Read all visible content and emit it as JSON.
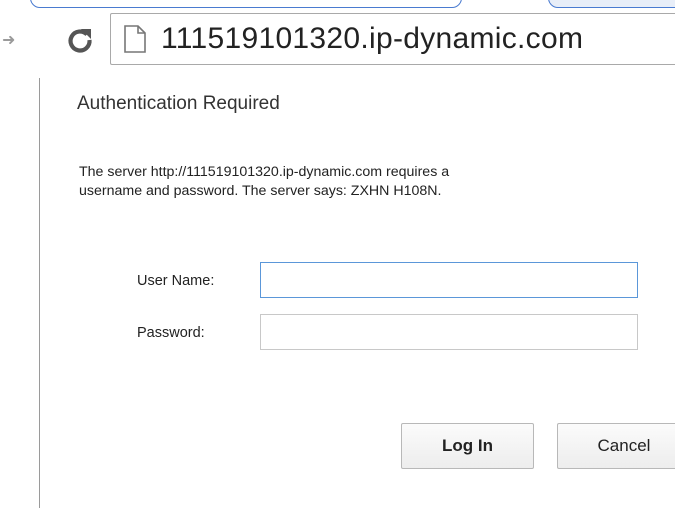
{
  "browser": {
    "address_bar": {
      "url": "111519101320.ip-dynamic.com"
    },
    "icons": {
      "forward": "forward-arrow-icon",
      "reload": "reload-icon",
      "page": "page-icon"
    }
  },
  "dialog": {
    "title": "Authentication Required",
    "message_line1": "The server http://111519101320.ip-dynamic.com requires a",
    "message_line2": "username and password. The server says: ZXHN H108N.",
    "username_label": "User Name:",
    "username_value": "",
    "password_label": "Password:",
    "password_value": "",
    "login_label": "Log In",
    "cancel_label": "Cancel"
  },
  "colors": {
    "focus_border": "#5b97d9",
    "tab_border": "#4a7bd0"
  }
}
